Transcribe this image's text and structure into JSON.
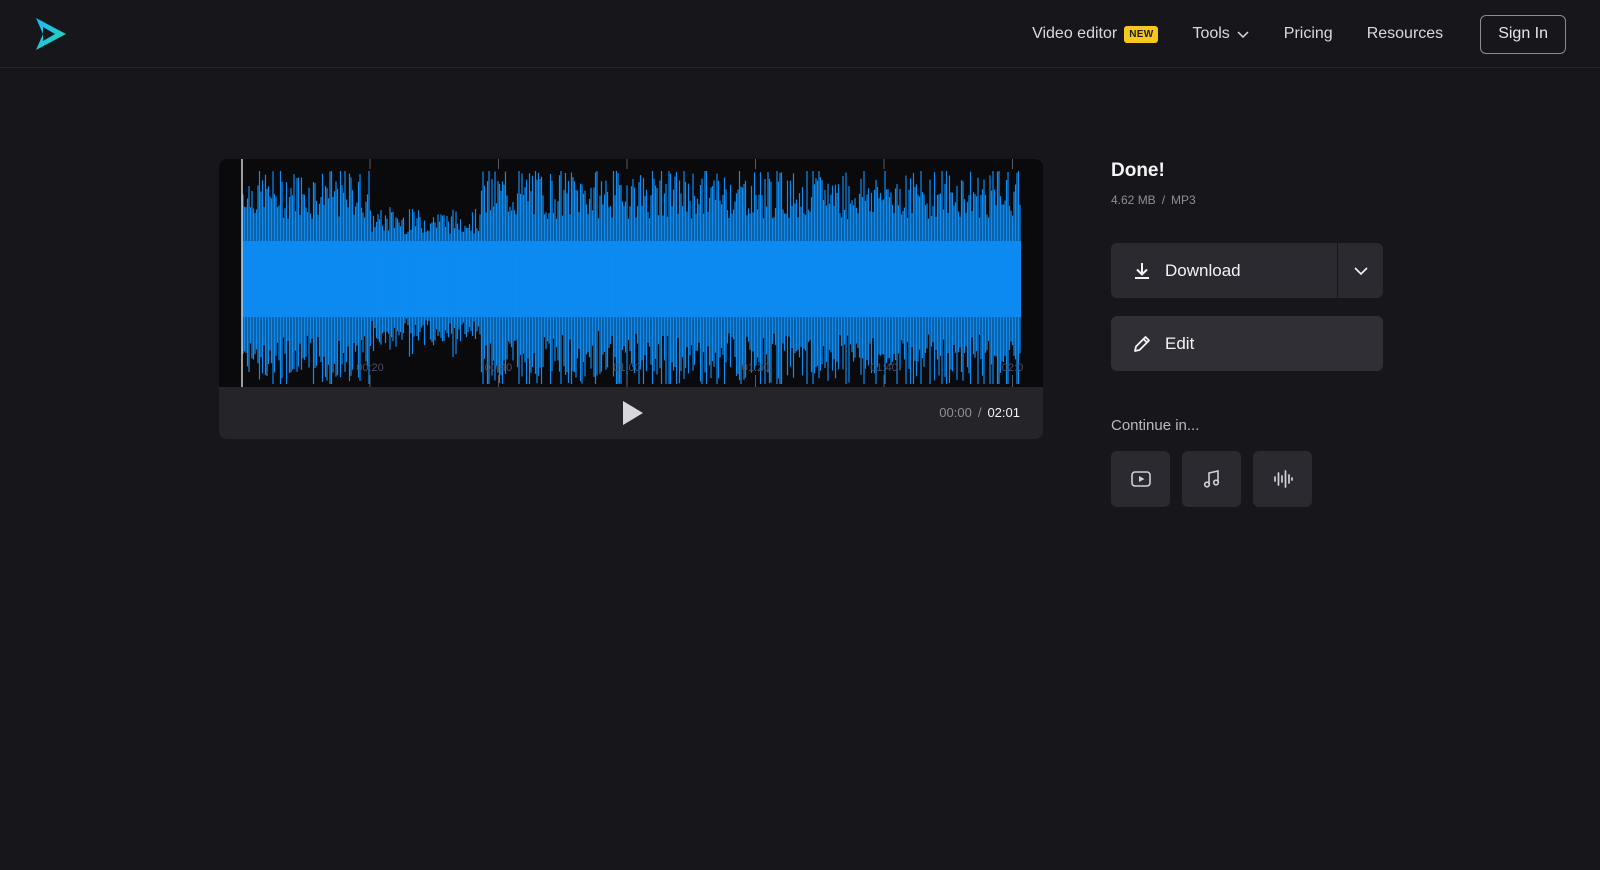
{
  "header": {
    "logo": "play-logo",
    "nav": {
      "video_editor": "Video editor",
      "new_badge": "NEW",
      "tools": "Tools",
      "pricing": "Pricing",
      "resources": "Resources",
      "sign_in": "Sign In"
    }
  },
  "player": {
    "timeline_labels": [
      "00:20",
      "00:40",
      "01:00",
      "01:20",
      "01:40",
      "02:0"
    ],
    "current_time": "00:00",
    "separator": "/",
    "total_time": "02:01",
    "waveform_color": "#0d8bf2"
  },
  "panel": {
    "title": "Done!",
    "file_size": "4.62 MB",
    "separator": "/",
    "format": "MP3",
    "download_label": "Download",
    "edit_label": "Edit",
    "continue_label": "Continue in...",
    "continue_icons": [
      "video-icon",
      "music-note-icon",
      "audio-waveform-icon"
    ]
  },
  "colors": {
    "background": "#16161b",
    "accent": "#0d8bf2",
    "badge": "#f7c71e"
  }
}
